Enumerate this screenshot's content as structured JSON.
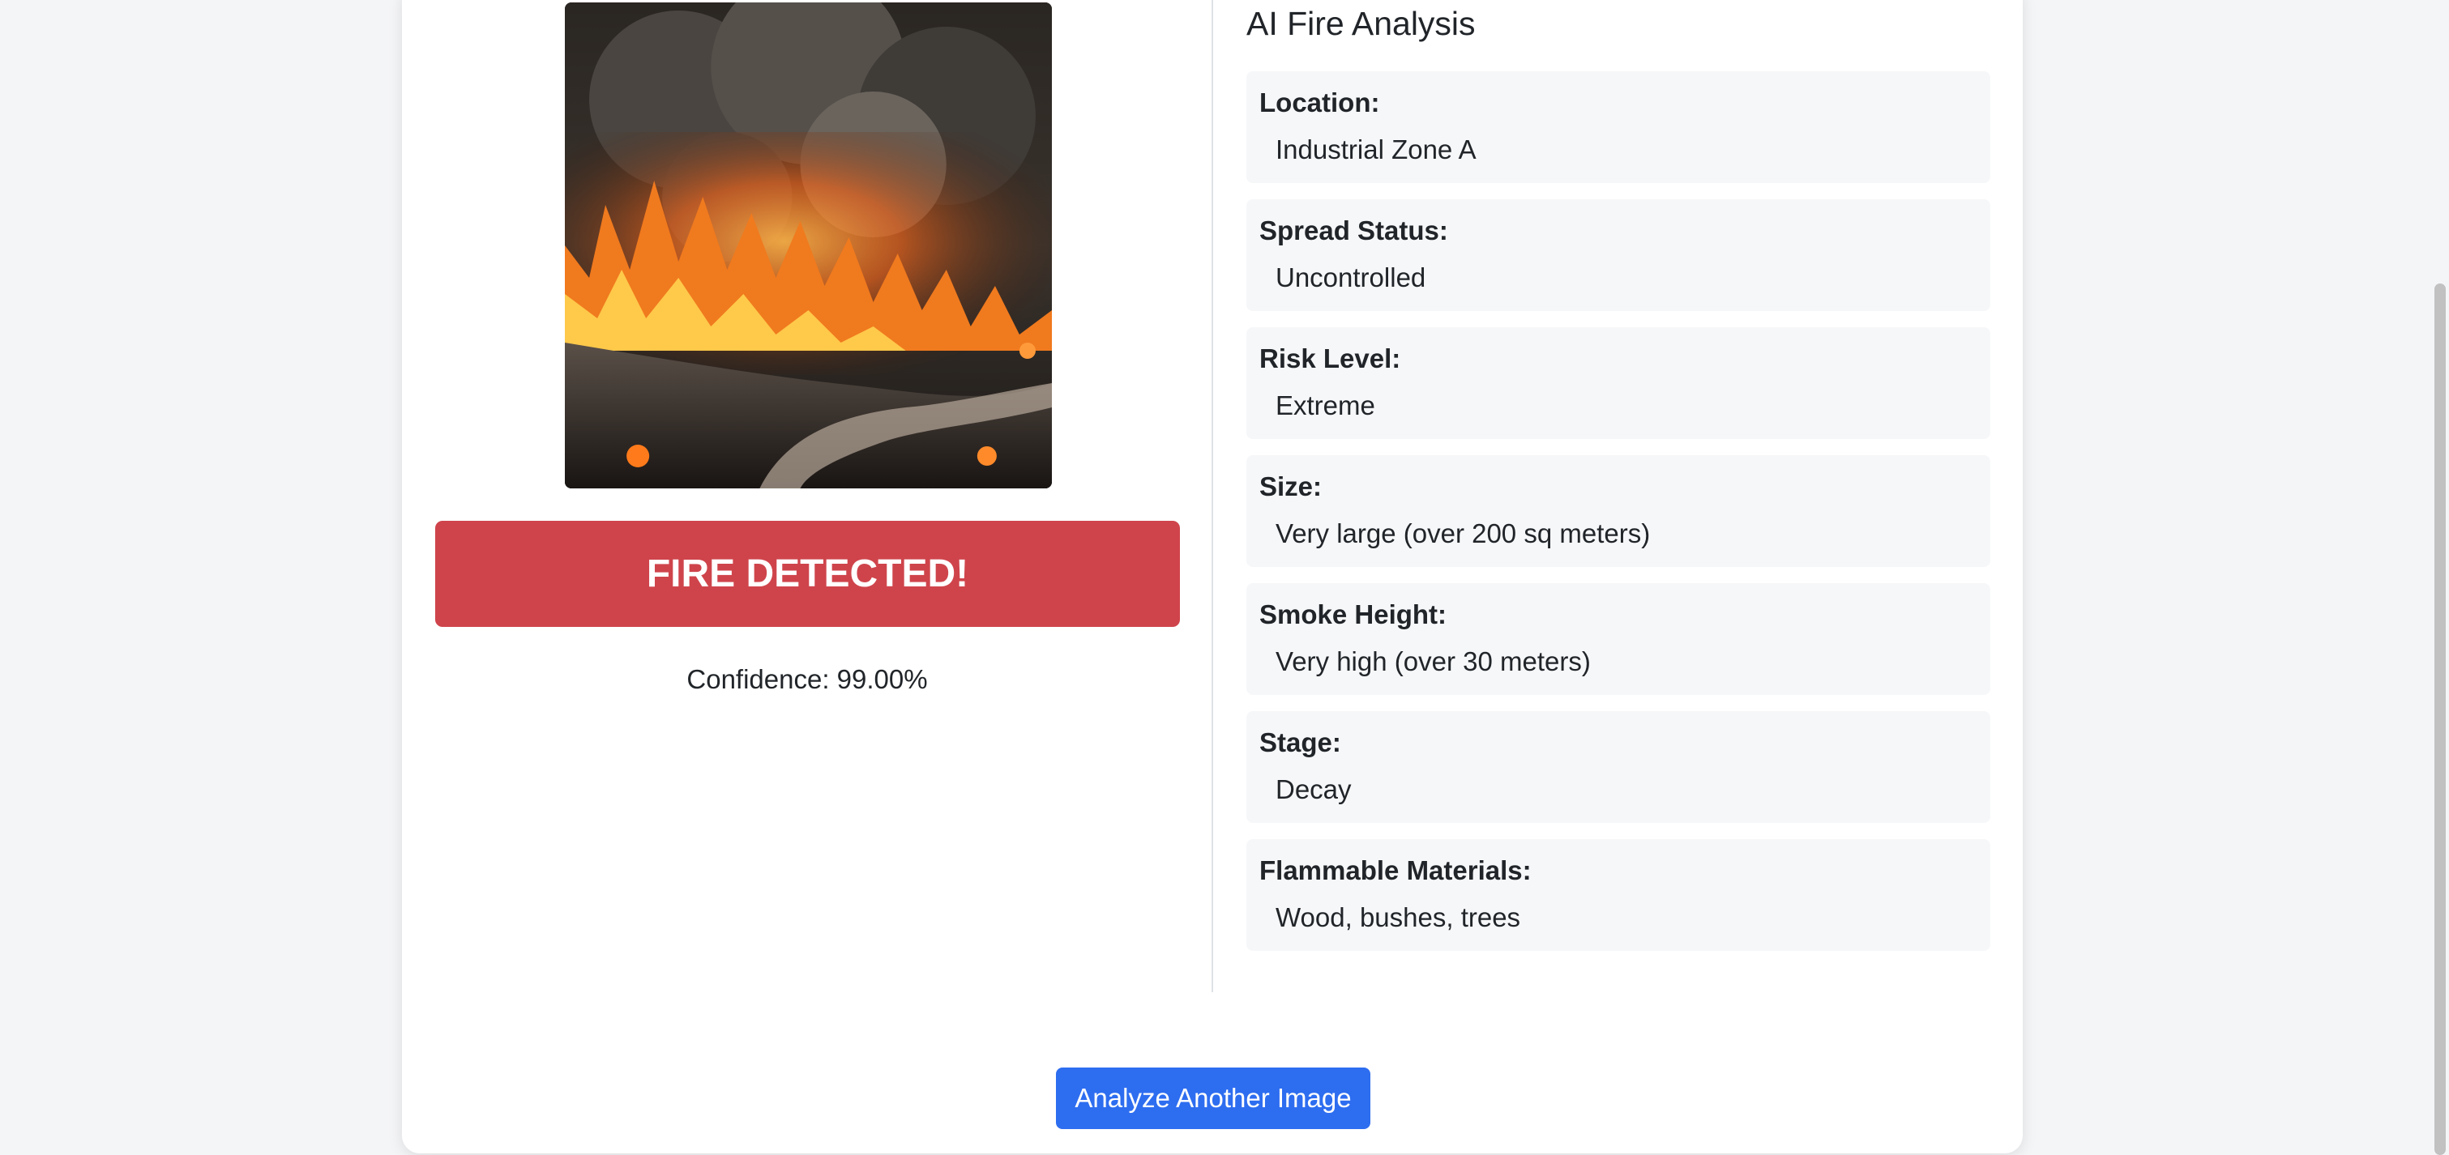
{
  "detection": {
    "image_alt": "Uploaded fire image",
    "alert_label": "FIRE DETECTED!",
    "confidence_text": "Confidence: 99.00%"
  },
  "analysis": {
    "title": "AI Fire Analysis",
    "fields": [
      {
        "label": "Location:",
        "value": "Industrial Zone A"
      },
      {
        "label": "Spread Status:",
        "value": "Uncontrolled"
      },
      {
        "label": "Risk Level:",
        "value": "Extreme"
      },
      {
        "label": "Size:",
        "value": "Very large (over 200 sq meters)"
      },
      {
        "label": "Smoke Height:",
        "value": "Very high (over 30 meters)"
      },
      {
        "label": "Stage:",
        "value": "Decay"
      },
      {
        "label": "Flammable Materials:",
        "value": "Wood, bushes, trees"
      }
    ]
  },
  "actions": {
    "analyze_another_label": "Analyze Another Image"
  },
  "colors": {
    "alert": "#cf444b",
    "primary_button": "#2d6df0",
    "field_background": "#f6f7f9",
    "page_background": "#f4f5f7"
  }
}
